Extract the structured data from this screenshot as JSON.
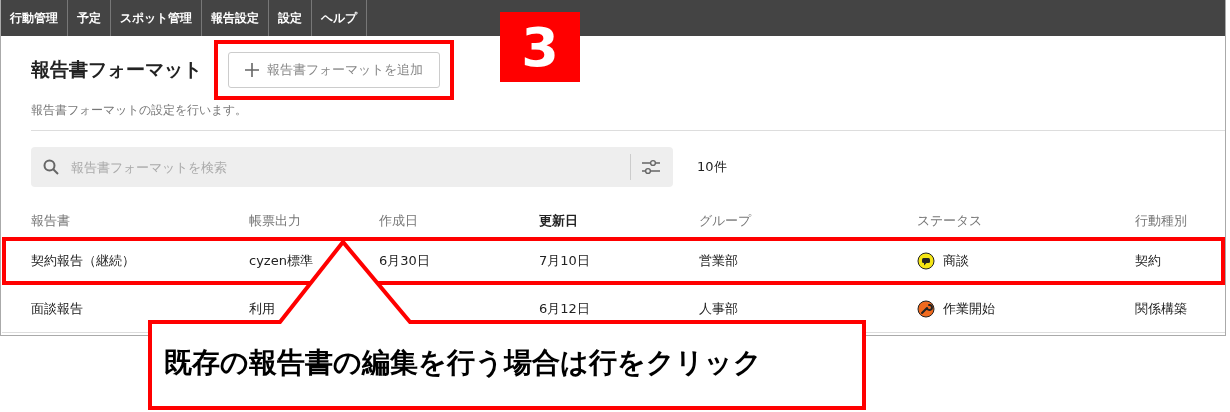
{
  "nav": [
    {
      "label": "行動管理"
    },
    {
      "label": "予定"
    },
    {
      "label": "スポット管理"
    },
    {
      "label": "報告設定"
    },
    {
      "label": "設定"
    },
    {
      "label": "ヘルプ"
    }
  ],
  "page": {
    "title": "報告書フォーマット",
    "description": "報告書フォーマットの設定を行います。",
    "add_button": {
      "label": "報告書フォーマットを追加",
      "highlighted": true
    }
  },
  "search": {
    "placeholder": "報告書フォーマットを検索",
    "count": "10件"
  },
  "table": {
    "columns": [
      {
        "label": "報告書",
        "sorted": false
      },
      {
        "label": "帳票出力",
        "sorted": false
      },
      {
        "label": "作成日",
        "sorted": false
      },
      {
        "label": "更新日",
        "sorted": true
      },
      {
        "label": "グループ",
        "sorted": false
      },
      {
        "label": "ステータス",
        "sorted": false
      },
      {
        "label": "行動種別",
        "sorted": false
      }
    ],
    "rows": [
      {
        "highlighted": true,
        "cells": [
          "契約報告（継続）",
          "cyzen標準",
          "6月30日",
          "7月10日",
          "営業部"
        ],
        "status": {
          "label": "商談",
          "kind": "chat",
          "color": "#f5e614"
        },
        "action_type": "契約"
      },
      {
        "highlighted": false,
        "cells": [
          "面談報告",
          "利用",
          "",
          "6月12日",
          "人事部"
        ],
        "status": {
          "label": "作業開始",
          "kind": "wrench",
          "color": "#f06a1e"
        },
        "action_type": "関係構築"
      }
    ]
  },
  "annotations": {
    "step_badge": "3",
    "callout": "既存の報告書の編集を行う場合は行をクリック"
  }
}
